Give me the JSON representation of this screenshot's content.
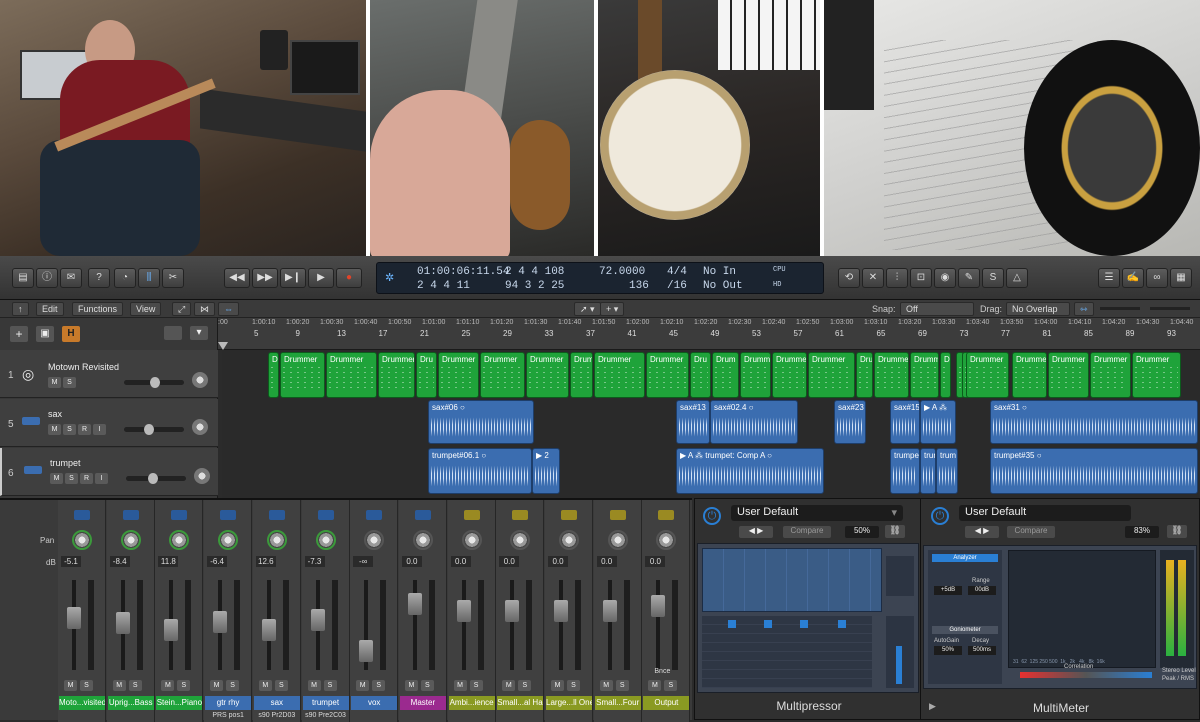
{
  "transport": {
    "position_time": "01:00:06:11.54",
    "position_bars": "2  4  4  108",
    "end_bars": "2  4  4  11",
    "locator": "94  3  2  25",
    "tempo": "72.0000",
    "tempo_sub": "136",
    "sig": "4/4",
    "division": "/16",
    "in": "No In",
    "out": "No Out",
    "cpu": "CPU",
    "hd": "HD"
  },
  "editbar": {
    "edit": "Edit",
    "functions": "Functions",
    "view": "View",
    "snap_label": "Snap:",
    "snap_value": "Off",
    "drag_label": "Drag:",
    "drag_value": "No Overlap"
  },
  "ruler": {
    "times": [
      ":00",
      "1:00:10",
      "1:00:20",
      "1:00:30",
      "1:00:40",
      "1:00:50",
      "1:01:00",
      "1:01:10",
      "1:01:20",
      "1:01:30",
      "1:01:40",
      "1:01:50",
      "1:02:00",
      "1:02:10",
      "1:02:20",
      "1:02:30",
      "1:02:40",
      "1:02:50",
      "1:03:00",
      "1:03:10",
      "1:03:20",
      "1:03:30",
      "1:03:40",
      "1:03:50",
      "1:04:00",
      "1:04:10",
      "1:04:20",
      "1:04:30",
      "1:04:40"
    ],
    "bars": [
      "5",
      "9",
      "13",
      "17",
      "21",
      "25",
      "29",
      "33",
      "37",
      "41",
      "45",
      "49",
      "53",
      "57",
      "61",
      "65",
      "69",
      "73",
      "77",
      "81",
      "85",
      "89",
      "93"
    ]
  },
  "tracks": [
    {
      "num": "1",
      "name": "Motown Revisited",
      "btns": [
        "M",
        "S"
      ]
    },
    {
      "num": "5",
      "name": "sax",
      "btns": [
        "M",
        "S",
        "R",
        "I"
      ]
    },
    {
      "num": "6",
      "name": "trumpet",
      "btns": [
        "M",
        "S",
        "R",
        "I"
      ]
    }
  ],
  "regions": {
    "drummer": "Drummer",
    "sax": [
      "sax#06",
      "sax#13",
      "sax#02.4",
      "sax#23",
      "sax#15",
      "sax#31"
    ],
    "trumpet": [
      "trumpet#06.1",
      "2",
      "trumpet: Comp A",
      "trumpet",
      "trur",
      "trum",
      "trumpet#35"
    ]
  },
  "mixer": {
    "pan_label": "Pan",
    "db_label": "dB",
    "channels": [
      {
        "name": "Moto...visited",
        "db": "-5.1",
        "color": "#1fa33a",
        "sub": ""
      },
      {
        "name": "Uprig...Bass",
        "db": "-8.4",
        "color": "#1fa33a",
        "sub": ""
      },
      {
        "name": "Stein...Piano",
        "db": "11.8",
        "color": "#1fa33a",
        "sub": ""
      },
      {
        "name": "gtr rhy",
        "db": "-6.4",
        "color": "#3b6db0",
        "sub": "PRS pos1"
      },
      {
        "name": "sax",
        "db": "12.6",
        "color": "#3b6db0",
        "sub": "s90 Pr2D03"
      },
      {
        "name": "trumpet",
        "db": "-7.3",
        "color": "#3b6db0",
        "sub": "s90 Pre2C03"
      },
      {
        "name": "vox",
        "db": "-∞",
        "color": "#3b6db0",
        "sub": ""
      },
      {
        "name": "Master",
        "db": "0.0",
        "color": "#9b2a8f",
        "sub": ""
      },
      {
        "name": "Ambi...ience",
        "db": "0.0",
        "color": "#8a9a22",
        "sub": ""
      },
      {
        "name": "Small...al Hall",
        "db": "0.0",
        "color": "#8a9a22",
        "sub": ""
      },
      {
        "name": "Large...ll One",
        "db": "0.0",
        "color": "#8a9a22",
        "sub": ""
      },
      {
        "name": "Small...Four",
        "db": "0.0",
        "color": "#8a9a22",
        "sub": ""
      },
      {
        "name": "Output",
        "db": "0.0",
        "color": "#8a9a22",
        "sub": ""
      }
    ],
    "bnce": "Bnce"
  },
  "plugin1": {
    "preset": "User Default",
    "compare": "Compare",
    "percent": "50%",
    "title": "Multipressor"
  },
  "plugin2": {
    "preset": "User Default",
    "compare": "Compare",
    "percent": "83%",
    "title": "MultiMeter",
    "analyzer": "Analyzer",
    "goniometer": "Goniometer",
    "autogain": "AutoGain",
    "autogain_val": "50%",
    "decay": "Decay",
    "decay_val": "500ms",
    "range": "Range",
    "range_val": "00dB",
    "top_val": "+5dB",
    "correlation": "Correlation",
    "stereo": "Stereo Level",
    "peakrms": "Peak / RMS",
    "freqs": "31  62  125 250 500  1k   2k   4k   8k  16k"
  },
  "colors": {
    "green": "#1fa33a",
    "blue": "#3b6db0",
    "accent": "#2a7fd4"
  }
}
